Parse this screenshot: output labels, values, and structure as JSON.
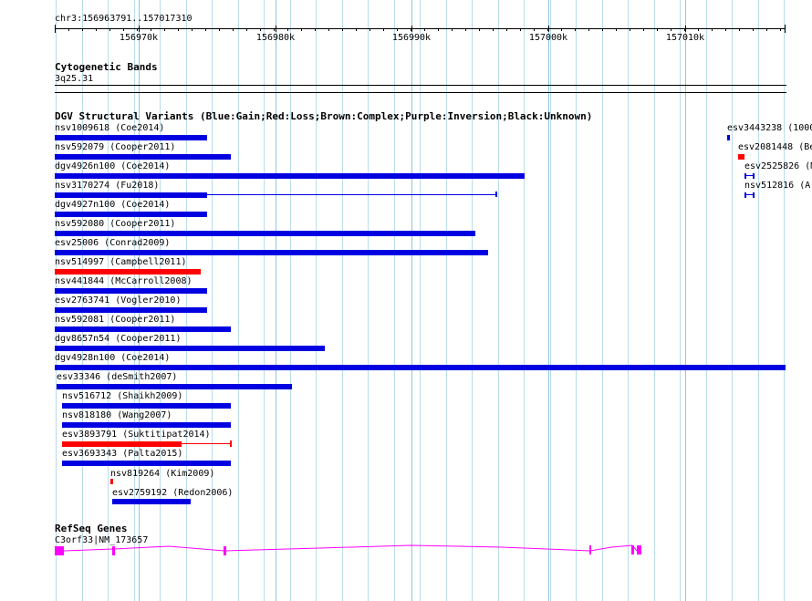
{
  "ruler": {
    "location": "chr3:156963791..157017310",
    "ticks": [
      "156970k",
      "156980k",
      "156990k",
      "157000k",
      "157010k"
    ]
  },
  "cytobands": {
    "title": "Cytogenetic Bands",
    "band": "3q25.31"
  },
  "dgv": {
    "title": "DGV Structural Variants (Blue:Gain;Red:Loss;Brown:Complex;Purple:Inversion;Black:Unknown)",
    "variants": [
      {
        "label": "nsv1009618 (Coe2014)",
        "color": "#0000e0"
      },
      {
        "label": "nsv592079 (Cooper2011)",
        "color": "#0000e0"
      },
      {
        "label": "dgv4926n100 (Coe2014)",
        "color": "#0000e0"
      },
      {
        "label": "nsv3170274 (Fu2018)",
        "color": "#0000e0"
      },
      {
        "label": "dgv4927n100 (Coe2014)",
        "color": "#0000e0"
      },
      {
        "label": "nsv592080 (Cooper2011)",
        "color": "#0000e0"
      },
      {
        "label": "esv25006 (Conrad2009)",
        "color": "#0000e0"
      },
      {
        "label": "nsv514997 (Campbell2011)",
        "color": "#ff0000"
      },
      {
        "label": "nsv441844 (McCarroll2008)",
        "color": "#0000e0"
      },
      {
        "label": "esv2763741 (Vogler2010)",
        "color": "#0000e0"
      },
      {
        "label": "nsv592081 (Cooper2011)",
        "color": "#0000e0"
      },
      {
        "label": "dgv8657n54 (Cooper2011)",
        "color": "#0000e0"
      },
      {
        "label": "dgv4928n100 (Coe2014)",
        "color": "#0000e0"
      },
      {
        "label": "esv33346 (deSmith2007)",
        "color": "#0000e0"
      },
      {
        "label": "nsv516712 (Shaikh2009)",
        "color": "#0000e0"
      },
      {
        "label": "nsv818180 (Wang2007)",
        "color": "#0000e0"
      },
      {
        "label": "esv3893791 (Suktitipat2014)",
        "color": "#ff0000"
      },
      {
        "label": "esv3693343 (Palta2015)",
        "color": "#0000e0"
      },
      {
        "label": "nsv819264 (Kim2009)",
        "color": "#ff0000"
      },
      {
        "label": "esv2759192 (Redon2006)",
        "color": "#0000e0"
      },
      {
        "label": "esv3443238 (1000",
        "color": "#0000e0"
      },
      {
        "label": "esv2081448 (Be",
        "color": "#ff0000"
      },
      {
        "label": "esv2525826 (M",
        "color": "#0000e0"
      },
      {
        "label": "nsv512816 (Ar",
        "color": "#0000e0"
      }
    ]
  },
  "refseq": {
    "title": "RefSeq Genes",
    "gene_label": "C3orf33|NM_173657",
    "color": "#ff00ff"
  }
}
